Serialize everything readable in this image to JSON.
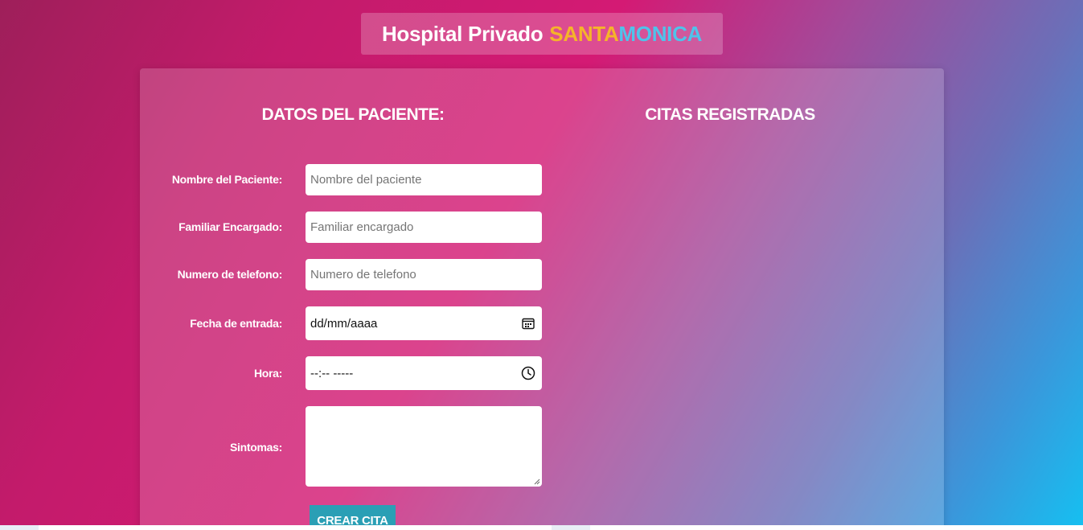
{
  "header": {
    "title_prefix": "Hospital Privado",
    "title_part1": "SANTA",
    "title_part2": "MONICA",
    "colors": {
      "santa": "#f5b42a",
      "monica": "#4fc3ea"
    }
  },
  "form": {
    "heading": "DATOS DEL PACIENTE:",
    "fields": [
      {
        "label": "Nombre del Paciente:",
        "placeholder": "Nombre del paciente"
      },
      {
        "label": "Familiar Encargado:",
        "placeholder": "Familiar encargado"
      },
      {
        "label": "Numero de telefono:",
        "placeholder": "Numero de telefono"
      },
      {
        "label": "Fecha de entrada:",
        "value": "dd/mm/aaaa",
        "icon": "calendar-icon"
      },
      {
        "label": "Hora:",
        "value": "--:-- -----",
        "icon": "clock-icon"
      },
      {
        "label": "Sintomas:",
        "value": ""
      }
    ],
    "submit_label": "CREAR CITA",
    "button_color": "#2a9fb5"
  },
  "citas": {
    "heading": "CITAS REGISTRADAS"
  }
}
